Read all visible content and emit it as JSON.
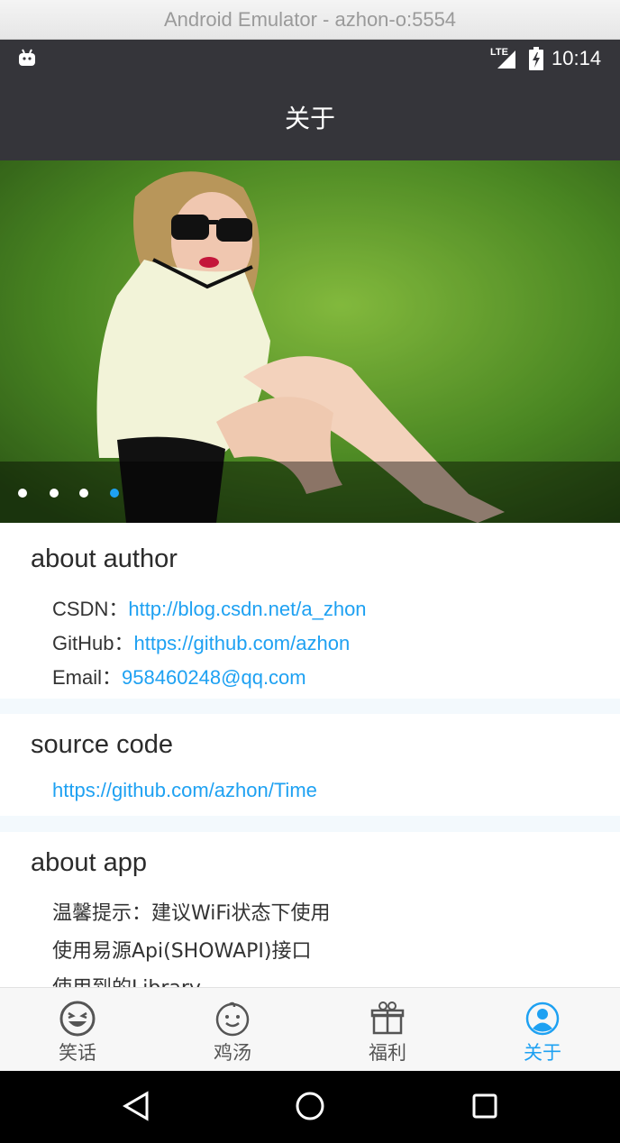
{
  "window": {
    "title": "Android Emulator - azhon-o:5554"
  },
  "status_bar": {
    "network": "LTE",
    "time": "10:14"
  },
  "app_bar": {
    "title": "关于"
  },
  "banner": {
    "pages": 4,
    "active_page": 4
  },
  "about_author": {
    "title": "about author",
    "csdn_label": "CSDN：",
    "csdn_link": "http://blog.csdn.net/a_zhon",
    "github_label": "GitHub：",
    "github_link": "https://github.com/azhon",
    "email_label": "Email：",
    "email_link": "958460248@qq.com"
  },
  "source_code": {
    "title": "source code",
    "link": "https://github.com/azhon/Time"
  },
  "about_app": {
    "title": "about app",
    "lines": [
      "温馨提示：建议WiFi状态下使用",
      "使用易源Api(SHOWAPI)接口",
      "使用到的Library"
    ]
  },
  "tabs": [
    {
      "label": "笑话",
      "icon": "laughing-face-icon"
    },
    {
      "label": "鸡汤",
      "icon": "baby-face-icon"
    },
    {
      "label": "福利",
      "icon": "gift-box-icon"
    },
    {
      "label": "关于",
      "icon": "user-profile-icon",
      "active": true
    }
  ],
  "colors": {
    "accent": "#1ea1f2",
    "bar": "#35353a",
    "tab_inactive": "#555555"
  }
}
